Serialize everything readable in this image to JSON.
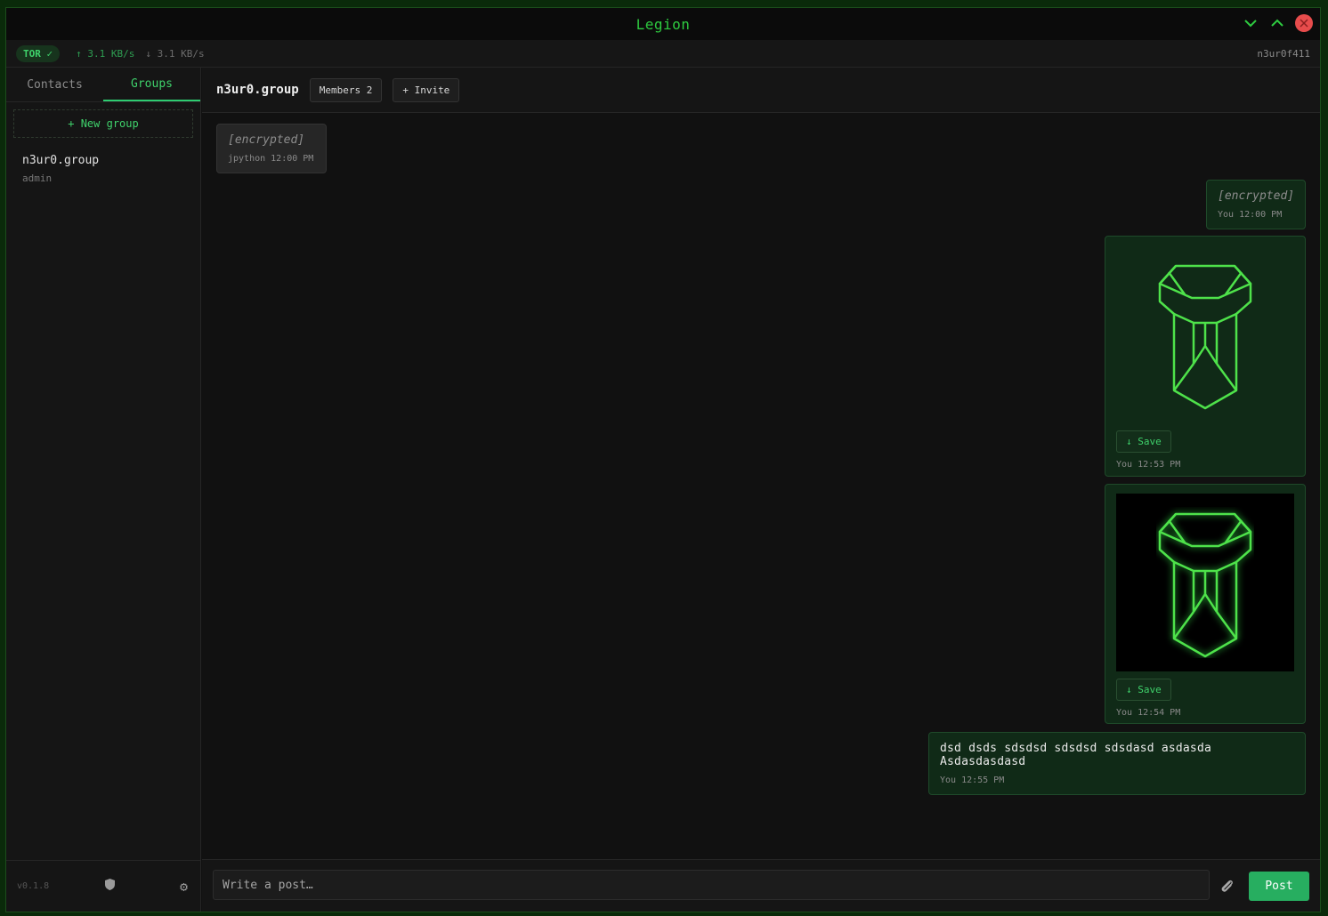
{
  "app": {
    "title": "Legion"
  },
  "status": {
    "tor": "TOR ✓",
    "upload": "↑ 3.1 KB/s",
    "download": "↓ 3.1 KB/s",
    "node_id": "n3ur0f411"
  },
  "sidebar": {
    "tabs": [
      {
        "label": "Contacts"
      },
      {
        "label": "Groups"
      }
    ],
    "active_tab": "Groups",
    "new_group": "+ New group",
    "groups": [
      {
        "name": "n3ur0.group",
        "role": "admin"
      }
    ],
    "version": "v0.1.8"
  },
  "chat": {
    "title": "n3ur0.group",
    "members_label": "Members 2",
    "invite_label": "+ Invite",
    "messages": [
      {
        "text": "[encrypted]",
        "sender": "jpython",
        "time": "12:00 PM"
      },
      {
        "text": "[encrypted]",
        "sender": "You",
        "time": "12:00 PM"
      },
      {
        "save": "↓ Save",
        "sender": "You",
        "time": "12:53 PM"
      },
      {
        "save": "↓ Save",
        "sender": "You",
        "time": "12:54 PM"
      },
      {
        "text": "dsd dsds sdsdsd sdsdsd sdsdasd asdasda Asdasdasdasd",
        "sender": "You",
        "time": "12:55 PM"
      }
    ]
  },
  "composer": {
    "placeholder": "Write a post…",
    "post_label": "Post"
  },
  "colors": {
    "accent": "#2ecc40",
    "post_button": "#27ae60",
    "close": "#e74c4c"
  },
  "icons": [
    "chevron-down-icon",
    "chevron-up-icon",
    "close-icon",
    "shield-icon",
    "gear-icon",
    "paperclip-icon",
    "legion-logo"
  ]
}
